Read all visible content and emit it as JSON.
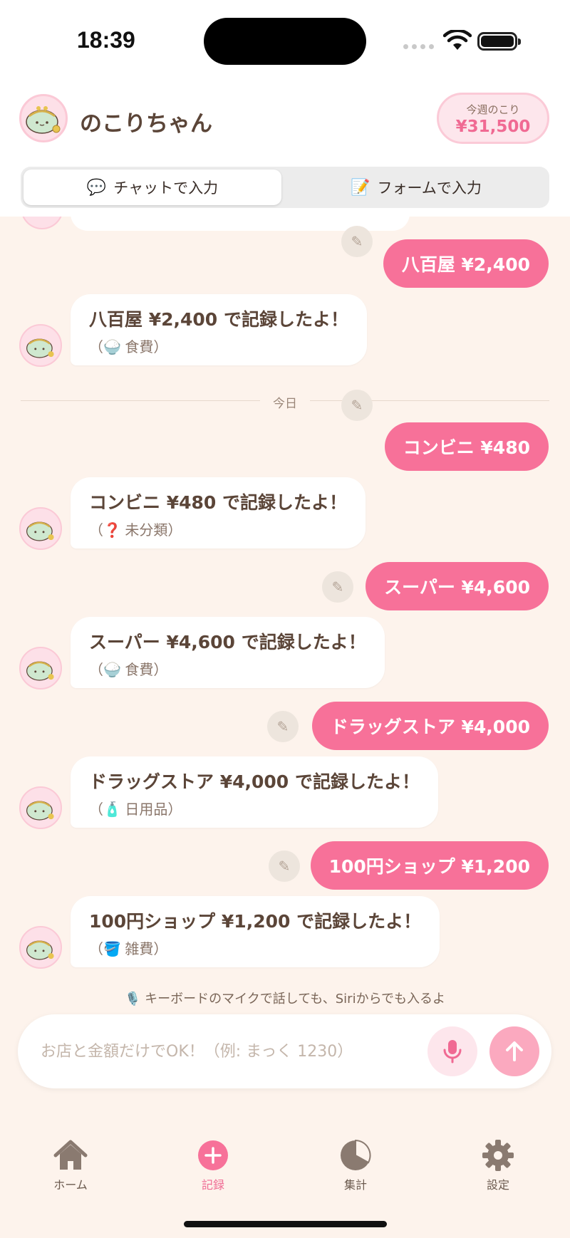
{
  "status": {
    "time": "18:39"
  },
  "header": {
    "title": "のこりちゃん",
    "remain_label": "今週のこり",
    "remain_value": "¥31,500"
  },
  "segment": {
    "chat_icon": "💬",
    "chat_label": "チャットで入力",
    "form_icon": "📝",
    "form_label": "フォームで入力"
  },
  "chat": {
    "divider_label": "今日",
    "messages": [
      {
        "user": "八百屋 ¥2,400",
        "bot_name": "八百屋",
        "bot_amount": "¥2,400",
        "bot_suffix": "で記録したよ！",
        "cat_icon": "🍚",
        "category": "食費"
      },
      {
        "user": "コンビニ ¥480",
        "bot_name": "コンビニ",
        "bot_amount": "¥480",
        "bot_suffix": "で記録したよ！",
        "cat_icon": "❓",
        "category": "未分類"
      },
      {
        "user": "スーパー ¥4,600",
        "bot_name": "スーパー",
        "bot_amount": "¥4,600",
        "bot_suffix": "で記録したよ！",
        "cat_icon": "🍚",
        "category": "食費"
      },
      {
        "user": "ドラッグストア ¥4,000",
        "bot_name": "ドラッグストア",
        "bot_amount": "¥4,000",
        "bot_suffix": "で記録したよ！",
        "cat_icon": "🧴",
        "category": "日用品"
      },
      {
        "user": "100円ショップ ¥1,200",
        "bot_name": "100円ショップ",
        "bot_amount": "¥1,200",
        "bot_suffix": "で記録したよ！",
        "cat_icon": "🪣",
        "category": "雑費"
      }
    ]
  },
  "hint": {
    "icon": "🎙️",
    "text": "キーボードのマイクで話しても、Siriからでも入るよ"
  },
  "input": {
    "placeholder": "お店と金額だけでOK！（例: まっく 1230）",
    "value": ""
  },
  "tabs": [
    {
      "label": "ホーム",
      "icon": "home-icon"
    },
    {
      "label": "記録",
      "icon": "plus-circle-icon"
    },
    {
      "label": "集計",
      "icon": "pie-chart-icon"
    },
    {
      "label": "設定",
      "icon": "gear-icon"
    }
  ],
  "colors": {
    "accent": "#f77199",
    "background": "#fdf3ec",
    "text": "#5b4538"
  }
}
